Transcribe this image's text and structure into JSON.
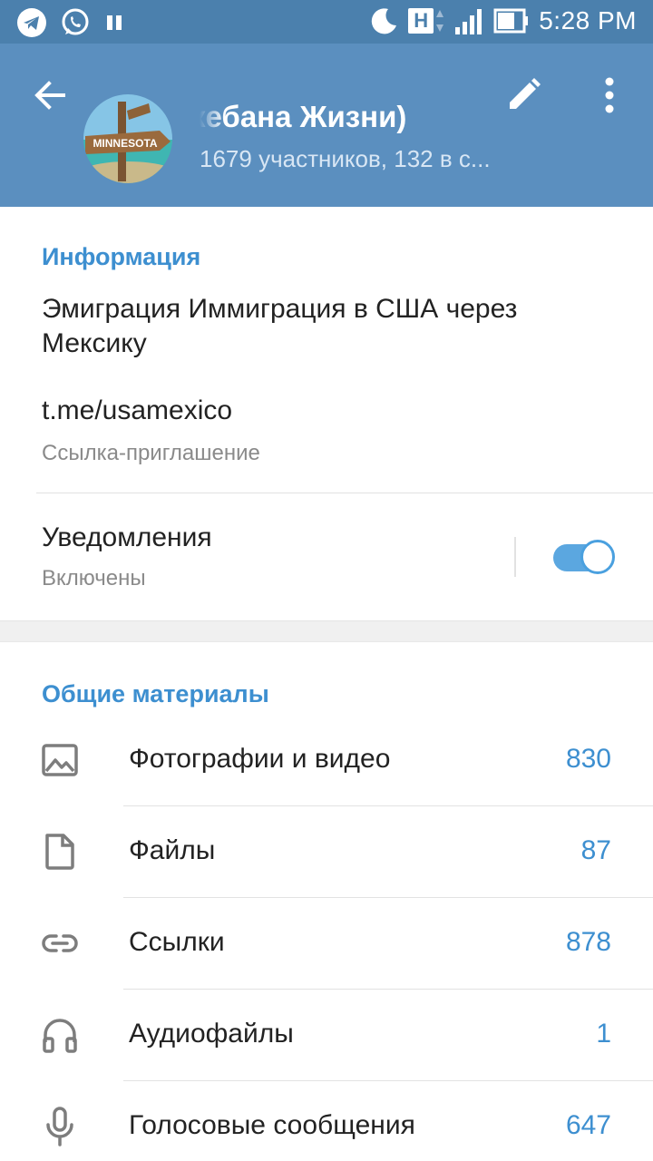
{
  "status_bar": {
    "time": "5:28 PM",
    "network_badge": "H",
    "icons": [
      "telegram-icon",
      "whatsapp-icon",
      "pause-icon",
      "moon-icon",
      "network-h-icon",
      "signal-icon",
      "battery-icon"
    ]
  },
  "header": {
    "title": "кебана Жизни)",
    "subtitle": "1679 участников, 132 в с...",
    "avatar_text": "MINNESOTA",
    "colors": {
      "status_bar": "#4b80ad",
      "header": "#5b8fbf"
    }
  },
  "info": {
    "section_title": "Информация",
    "description": "Эмиграция Иммиграция в США через Мексику",
    "link": "t.me/usamexico",
    "link_caption": "Ссылка-приглашение",
    "notifications_label": "Уведомления",
    "notifications_state": "Включены",
    "notifications_enabled": true
  },
  "shared": {
    "section_title": "Общие материалы",
    "items": [
      {
        "label": "Фотографии и видео",
        "count": "830",
        "icon": "photo-icon"
      },
      {
        "label": "Файлы",
        "count": "87",
        "icon": "file-icon"
      },
      {
        "label": "Ссылки",
        "count": "878",
        "icon": "link-icon"
      },
      {
        "label": "Аудиофайлы",
        "count": "1",
        "icon": "headphones-icon"
      },
      {
        "label": "Голосовые сообщения",
        "count": "647",
        "icon": "microphone-icon"
      }
    ]
  },
  "accent_color": "#3d8fd0"
}
